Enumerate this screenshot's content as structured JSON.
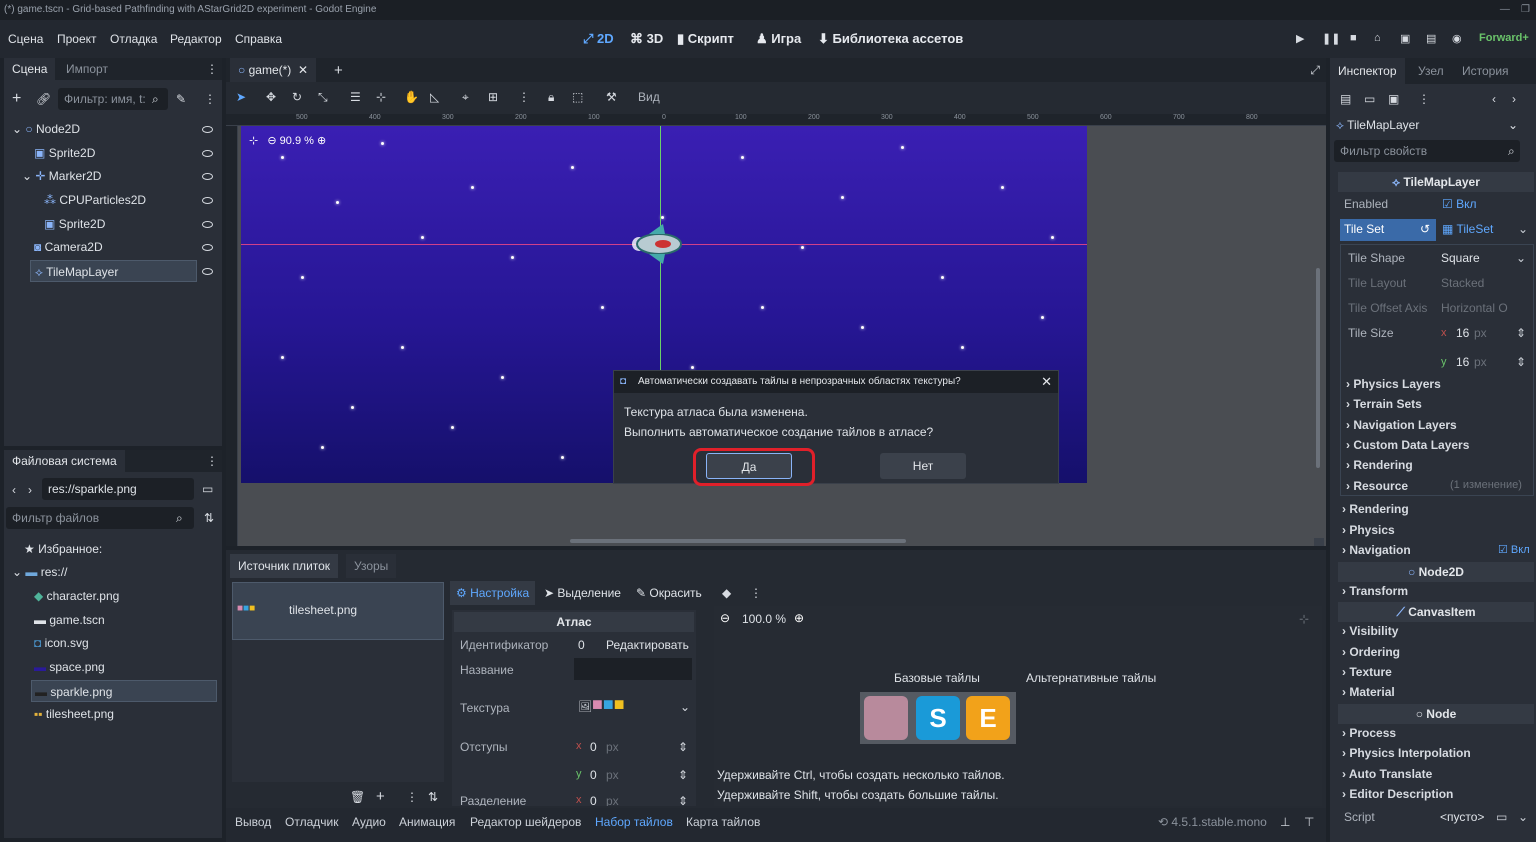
{
  "window": {
    "title": "(*) game.tscn - Grid-based Pathfinding with AStarGrid2D experiment - Godot Engine"
  },
  "menu": [
    "Сцена",
    "Проект",
    "Отладка",
    "Редактор",
    "Справка"
  ],
  "workspaces": [
    "2D",
    "3D",
    "Скрипт",
    "Игра",
    "Библиотека ассетов"
  ],
  "renderer": "Forward+",
  "scene_dock": {
    "tabs": [
      "Сцена",
      "Импорт"
    ],
    "filter_placeholder": "Фильтр: имя, t:",
    "nodes": [
      "Node2D",
      "Sprite2D",
      "Marker2D",
      "CPUParticles2D",
      "Sprite2D",
      "Camera2D",
      "TileMapLayer"
    ]
  },
  "fs_dock": {
    "title": "Файловая система",
    "path": "res://sparkle.png",
    "filter_placeholder": "Фильтр файлов",
    "favorites": "Избранное:",
    "root": "res://",
    "files": [
      "character.png",
      "game.tscn",
      "icon.svg",
      "space.png",
      "sparkle.png",
      "tilesheet.png"
    ]
  },
  "editor": {
    "tab": "game(*)",
    "view_label": "Вид",
    "zoom": "90.9 %"
  },
  "ruler_labels": [
    "500",
    "400",
    "300",
    "200",
    "100",
    "0",
    "100",
    "200",
    "300",
    "400",
    "500",
    "600",
    "700",
    "800"
  ],
  "dialog": {
    "title": "Автоматически создавать тайлы в непрозрачных областях текстуры?",
    "line1": "Текстура атласа была изменена.",
    "line2": "Выполнить автоматическое создание тайлов в атласе?",
    "yes": "Да",
    "no": "Нет"
  },
  "tileset": {
    "tabs": [
      "Источник плиток",
      "Узоры"
    ],
    "source": "tilesheet.png",
    "subtabs": [
      "Настройка",
      "Выделение",
      "Окрасить"
    ],
    "atlas_header": "Атлас",
    "id_label": "Идентификатор",
    "id_value": "0",
    "edit_label": "Редактировать",
    "name_label": "Название",
    "texture_label": "Текстура",
    "margins_label": "Отступы",
    "separation_label": "Разделение",
    "margin_x": "0",
    "margin_y": "0",
    "sep_x": "0",
    "px": "px",
    "x": "x",
    "y": "y",
    "zoom": "100.0 %",
    "base_tiles": "Базовые тайлы",
    "alt_tiles": "Альтернативные тайлы",
    "hint1": "Удерживайте Ctrl, чтобы создать несколько тайлов.",
    "hint2": "Удерживайте Shift, чтобы создать большие тайлы."
  },
  "bottom_tabs": [
    "Вывод",
    "Отладчик",
    "Аудио",
    "Анимация",
    "Редактор шейдеров",
    "Набор тайлов",
    "Карта тайлов"
  ],
  "version": "4.5.1.stable.mono",
  "inspector": {
    "tabs": [
      "Инспектор",
      "Узел",
      "История"
    ],
    "object": "TileMapLayer",
    "filter_placeholder": "Фильтр свойств",
    "header": "TileMapLayer",
    "enabled_label": "Enabled",
    "on": "Вкл",
    "tileset_label": "Tile Set",
    "tileset_value": "TileSet",
    "shape_label": "Tile Shape",
    "shape_value": "Square",
    "layout_label": "Tile Layout",
    "layout_value": "Stacked",
    "offset_label": "Tile Offset Axis",
    "offset_value": "Horizontal O",
    "size_label": "Tile Size",
    "size_x": "16",
    "size_y": "16",
    "tileset_sections": [
      "Physics Layers",
      "Terrain Sets",
      "Navigation Layers",
      "Custom Data Layers",
      "Rendering"
    ],
    "resource": "Resource",
    "resource_changes": "(1 изменение)",
    "layer_sections": [
      "Rendering",
      "Physics",
      "Navigation"
    ],
    "node2d": "Node2D",
    "transform": "Transform",
    "canvasitem": "CanvasItem",
    "canvas_sections": [
      "Visibility",
      "Ordering",
      "Texture",
      "Material"
    ],
    "node": "Node",
    "node_sections": [
      "Process",
      "Physics Interpolation",
      "Auto Translate",
      "Editor Description"
    ],
    "script_label": "Script",
    "script_value": "<пусто>"
  },
  "colors": {
    "accent": "#5fa8ff",
    "selection": "#3a4452",
    "highlight": "#e0202a"
  }
}
